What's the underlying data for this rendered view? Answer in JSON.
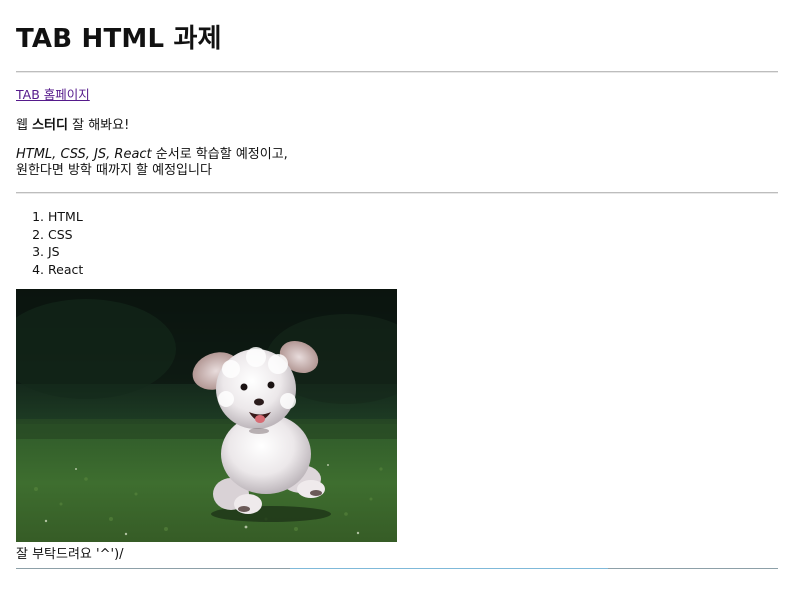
{
  "heading": "TAB HTML 과제",
  "link": {
    "label": "TAB 홈페이지"
  },
  "intro": {
    "prefix": "웹 ",
    "bold": "스터디",
    "suffix": " 잘 해봐요!"
  },
  "plan": {
    "italic": "HTML, CSS, JS, React",
    "line1_rest": " 순서로 학습할 예정이고,",
    "line2": "원한다면 방학 때까지 할 예정입니다"
  },
  "topics": [
    "HTML",
    "CSS",
    "JS",
    "React"
  ],
  "image": {
    "subject": "white fluffy dog running on grass",
    "icon": "photo"
  },
  "caption": "잘 부탁드려요 '^')/",
  "colors": {
    "link_visited": "#551a8b",
    "divider": "#bdbdbd"
  }
}
